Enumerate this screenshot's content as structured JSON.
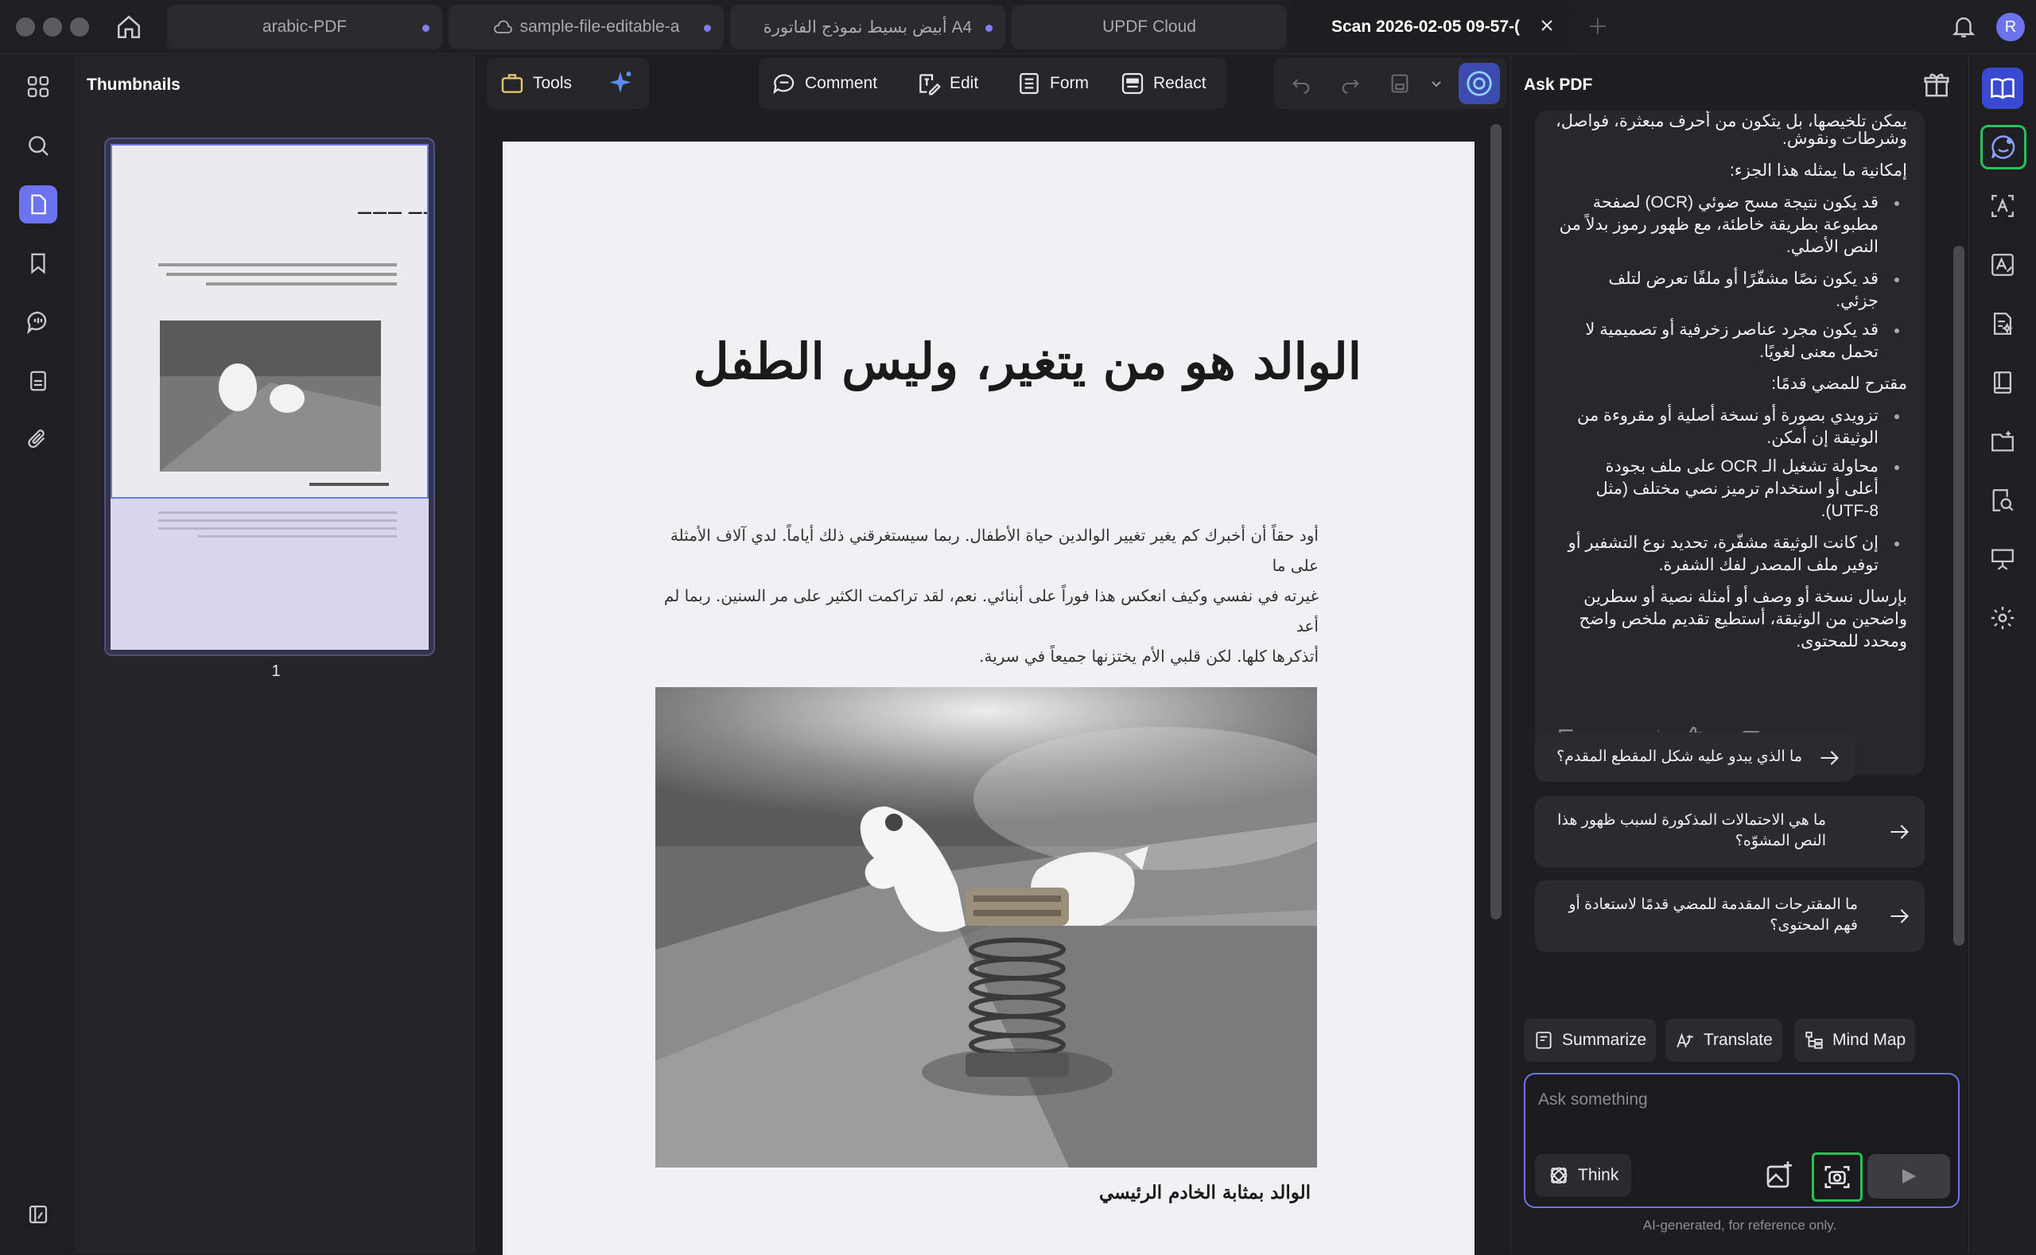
{
  "colors": {
    "accent": "#6c73ee",
    "highlight": "#25c15a",
    "tab_dot": "#7d7ff0"
  },
  "tabs": [
    {
      "label": "arabic-PDF",
      "modified": true
    },
    {
      "label": "sample-file-editable-a",
      "modified": true,
      "icon": "cloud-icon"
    },
    {
      "label": "A4 أبيض بسيط نموذج الفاتورة",
      "modified": true
    },
    {
      "label": "UPDF Cloud",
      "modified": false
    },
    {
      "label": "Scan 2026-02-05 09-57-(",
      "modified": false,
      "active": true
    }
  ],
  "user_initial": "R",
  "thumbnails": {
    "title": "Thumbnails",
    "page_number": "1"
  },
  "toolbar": {
    "tools": "Tools",
    "comment": "Comment",
    "edit": "Edit",
    "form": "Form",
    "redact": "Redact"
  },
  "document": {
    "title": "الوالد هو من يتغير، وليس الطفل",
    "paragraph": [
      "أود حقاً أن أخبرك كم يغير تغيير الوالدين حياة الأطفال. ربما سيستغرقني ذلك أياماً. لدي آلاف الأمثلة على ما",
      "غيرته في نفسي وكيف انعكس هذا فوراً على أبنائي. نعم، لقد تراكمت الكثير على مر السنين. ربما لم أعد",
      "أتذكرها كلها. لكن قلبي الأم يختزنها جميعاً في سرية."
    ],
    "caption": "الوالد بمثابة الخادم الرئيسي"
  },
  "chat": {
    "title": "Ask PDF",
    "answer_lines": [
      {
        "text": "يمكن تلخيصها، بل يتكون من أحرف مبعثرة، فواصل،",
        "bullet": false
      },
      {
        "text": "وشرطات ونقوش.",
        "bullet": false
      },
      {
        "text": "إمكانية ما يمثله هذا الجزء:",
        "bullet": false
      },
      {
        "text": "قد يكون نتيجة مسح ضوئي (OCR) لصفحة",
        "bullet": true
      },
      {
        "text": "مطبوعة بطريقة خاطئة، مع ظهور رموز بدلاً من",
        "bullet": false
      },
      {
        "text": "النص الأصلي.",
        "bullet": false
      },
      {
        "text": "قد يكون نصًا مشفّرًا أو ملفًا تعرض لتلف",
        "bullet": true
      },
      {
        "text": "جزئي.",
        "bullet": false
      },
      {
        "text": "قد يكون مجرد عناصر زخرفية أو تصميمية لا",
        "bullet": true
      },
      {
        "text": "تحمل معنى لغويًا.",
        "bullet": false
      },
      {
        "text": "مقترح للمضي قدمًا:",
        "bullet": false
      },
      {
        "text": "تزويدي بصورة أو نسخة أصلية أو مقروءة من",
        "bullet": true
      },
      {
        "text": "الوثيقة إن أمكن.",
        "bullet": false
      },
      {
        "text": "محاولة تشغيل الـ OCR على ملف بجودة",
        "bullet": true
      },
      {
        "text": "أعلى أو استخدام ترميز نصي مختلف (مثل",
        "bullet": false
      },
      {
        "text": "UTF-8).",
        "bullet": false
      },
      {
        "text": "إن كانت الوثيقة مشفّرة، تحديد نوع التشفير أو",
        "bullet": true
      },
      {
        "text": "توفير ملف المصدر لفك الشفرة.",
        "bullet": false
      },
      {
        "text": "بإرسال نسخة أو وصف أو أمثلة نصية أو سطرين",
        "bullet": false
      },
      {
        "text": "واضحين من الوثيقة، أستطيع تقديم ملخص واضح",
        "bullet": false
      },
      {
        "text": "ومحدد للمحتوى.",
        "bullet": false
      }
    ],
    "suggestions": [
      [
        "ما الذي يبدو عليه شكل المقطع المقدم؟"
      ],
      [
        "ما هي الاحتمالات المذكورة لسبب ظهور هذا",
        "النص المشوّه؟"
      ],
      [
        "ما المقترحات المقدمة للمضي قدمًا لاستعادة أو",
        "فهم المحتوى؟"
      ]
    ],
    "actions": {
      "summarize": "Summarize",
      "translate": "Translate",
      "mind_map": "Mind Map"
    },
    "input_placeholder": "Ask something",
    "think": "Think",
    "disclaimer": "AI-generated, for reference only."
  }
}
